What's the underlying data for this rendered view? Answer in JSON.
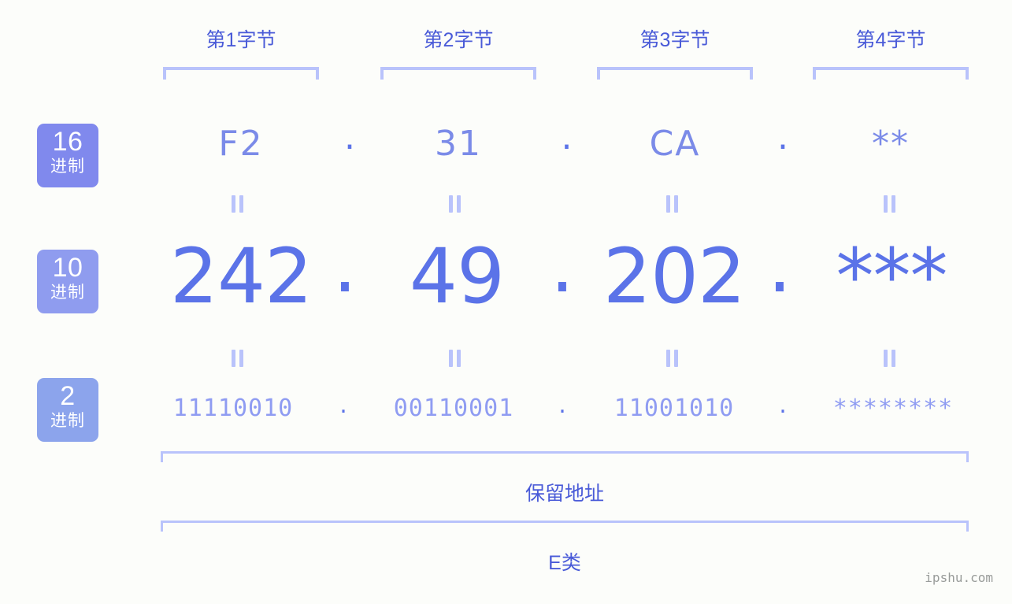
{
  "background_color": "#fcfdfa",
  "colors": {
    "header_text": "#4a5bd8",
    "bracket": "#b9c3fb",
    "hex_value": "#7b8be8",
    "dec_value": "#5b73e8",
    "bin_value": "#8f9cf2",
    "separator_dot": "#5b73e8",
    "badge_hex": "#8089ed",
    "badge_dec": "#8f9cef",
    "badge_bin": "#8ca4ec",
    "watermark": "#999c9a"
  },
  "byte_headers": [
    {
      "label": "第1字节"
    },
    {
      "label": "第2字节"
    },
    {
      "label": "第3字节"
    },
    {
      "label": "第4字节"
    }
  ],
  "radix_badges": [
    {
      "number": "16",
      "system": "进制"
    },
    {
      "number": "10",
      "system": "进制"
    },
    {
      "number": "2",
      "system": "进制"
    }
  ],
  "rows": {
    "hex": {
      "values": [
        "F2",
        "31",
        "CA",
        "**"
      ],
      "separators": [
        ".",
        ".",
        "."
      ]
    },
    "decimal": {
      "values": [
        "242",
        "49",
        "202",
        "***"
      ],
      "separators": [
        ".",
        ".",
        "."
      ]
    },
    "binary": {
      "values": [
        "11110010",
        "00110001",
        "11001010",
        "********"
      ],
      "separators": [
        ".",
        ".",
        "."
      ]
    }
  },
  "equals_marks": {
    "glyph": "=",
    "hex_to_dec_count": 4,
    "dec_to_bin_count": 4
  },
  "bottom_brackets": [
    {
      "label": "保留地址"
    },
    {
      "label": "E类"
    }
  ],
  "watermark": {
    "text": "ipshu.com"
  }
}
